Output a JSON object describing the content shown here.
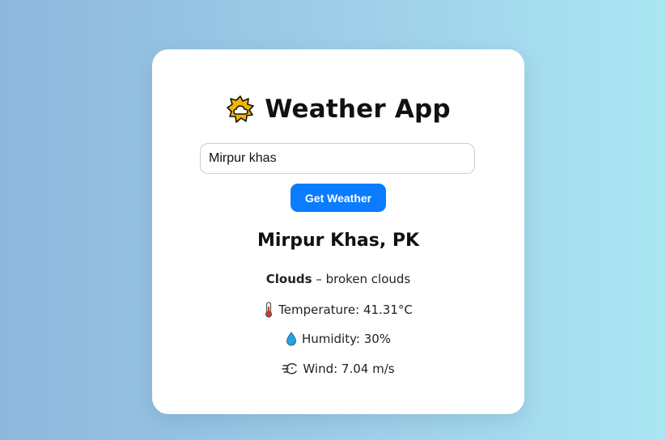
{
  "app": {
    "title": "Weather App",
    "title_icon": "sun-behind-cloud-icon"
  },
  "search": {
    "value": "Mirpur khas",
    "placeholder": ""
  },
  "button": {
    "label": "Get Weather"
  },
  "result": {
    "city": "Mirpur Khas, PK",
    "condition_main": "Clouds",
    "condition_sep": " – ",
    "condition_desc": "broken clouds",
    "temperature": {
      "icon": "thermometer-icon",
      "text": "Temperature: 41.31°C"
    },
    "humidity": {
      "icon": "droplet-icon",
      "text": "Humidity: 30%"
    },
    "wind": {
      "icon": "wind-face-icon",
      "text": "Wind: 7.04 m/s"
    }
  },
  "colors": {
    "accent": "#0a7cff",
    "card": "#ffffff"
  }
}
